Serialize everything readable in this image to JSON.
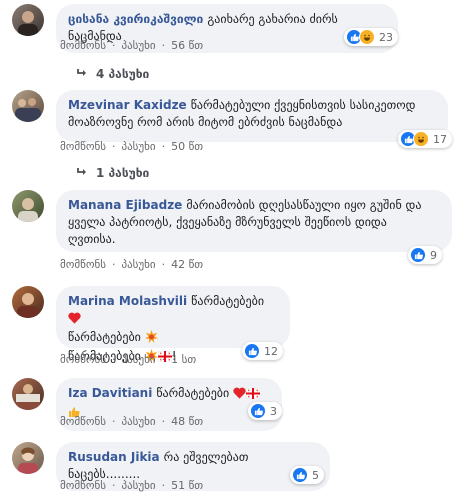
{
  "comments": [
    {
      "author": "ცისანა კვირიკაშვილი",
      "text": "გაიხარე გახარია ძირს ნაცმანდა",
      "reactions": [
        "like",
        "haha"
      ],
      "reaction_count": "23",
      "actions": {
        "like": "მომწონს",
        "reply": "პასუხი",
        "time": "56 წთ"
      },
      "replies": "4 პასუხი"
    },
    {
      "author": "Mzevinar Kaxidze",
      "text_line1": "წარმატებული ქვეყნისთვის სასიკეთოდ",
      "text_line2": "მოაზროვნე რომ არის მიტომ ებრძვის ნაცმანდა",
      "reactions": [
        "like",
        "haha"
      ],
      "reaction_count": "17",
      "actions": {
        "like": "მომწონს",
        "reply": "პასუხი",
        "time": "50 წთ"
      },
      "replies": "1 პასუხი"
    },
    {
      "author": "Manana Ejibadze",
      "text_line1": "მარიამობის დღესასწაული იყო გუშინ და",
      "text_line2": "ყველა პატრიოტს, ქვეყანაზე მზრუნველს შეეწიოს დიდა",
      "text_line3": "ღვთისა.",
      "reactions": [
        "like"
      ],
      "reaction_count": "9",
      "actions": {
        "like": "მომწონს",
        "reply": "პასუხი",
        "time": "42 წთ"
      }
    },
    {
      "author": "Marina Molashvili",
      "text_line1": "წარმატებები",
      "text_line2": "წარმატებები",
      "text_line3": "წარმატებები",
      "text_line3_end": "!",
      "reactions": [
        "like"
      ],
      "reaction_count": "12",
      "actions": {
        "like": "მომწონს",
        "reply": "პასუხი",
        "time": "1 სთ"
      }
    },
    {
      "author": "Iza Davitiani",
      "text": "წარმატებები",
      "reactions": [
        "like"
      ],
      "reaction_count": "3",
      "actions": {
        "like": "მომწონს",
        "reply": "პასუხი",
        "time": "48 წთ"
      }
    },
    {
      "author": "Rusudan Jikia",
      "text": "რა ეშველებათ ნაცებს.........",
      "reactions": [
        "like"
      ],
      "reaction_count": "5",
      "actions": {
        "like": "მომწონს",
        "reply": "პასუხი",
        "time": "51 წთ"
      }
    }
  ],
  "colors": {
    "author": "#385898",
    "bubble": "#f0f2f5",
    "like": "#1877f2",
    "meta": "#65676b"
  },
  "icons": [
    "like-icon",
    "haha-icon",
    "heart-emoji",
    "fire-emoji",
    "georgian-flag-emoji",
    "thumbs-up-emoji",
    "reply-arrow-icon"
  ]
}
